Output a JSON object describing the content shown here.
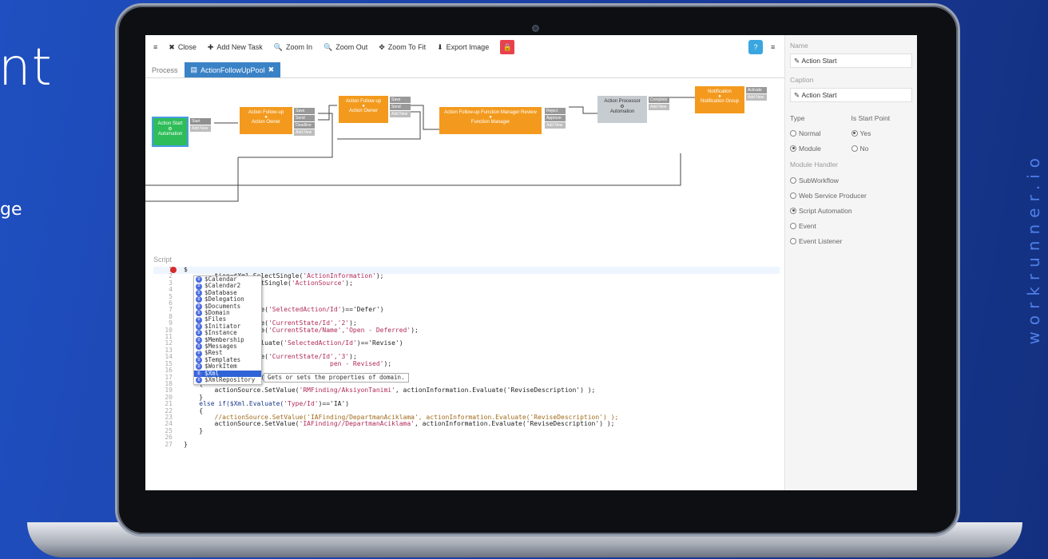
{
  "hero": {
    "title": "nt",
    "subtitle": "ge"
  },
  "brand": {
    "vertical": "workrunner.io"
  },
  "toolbar": {
    "menu_icon": "≡",
    "close": "Close",
    "add_task": "Add New Task",
    "zoom_in": "Zoom In",
    "zoom_out": "Zoom Out",
    "zoom_fit": "Zoom To Fit",
    "export": "Export Image",
    "help": "?",
    "menu2": "≡"
  },
  "tabs": {
    "process": "Process",
    "active": "ActionFollowUpPool"
  },
  "diagram": {
    "nodes": [
      {
        "title": "Action Start",
        "sub": "Automation",
        "color": "#2ebd59",
        "ports": [
          "Start",
          "Add New"
        ]
      },
      {
        "title": "Action Follow-up",
        "sub": "Action Owner",
        "color": "#f39a1e",
        "ports": [
          "Save",
          "Send",
          "Deadline",
          "Add New"
        ]
      },
      {
        "title": "Action Follow-up",
        "sub": "Action Owner",
        "color": "#f39a1e",
        "ports": [
          "Save",
          "Send",
          "Add New"
        ]
      },
      {
        "title": "Action Follow-up Function Manager Review",
        "sub": "Function Manager",
        "color": "#f39a1e",
        "ports": [
          "Reject",
          "Approve",
          "Add New"
        ]
      },
      {
        "title": "Action Processor",
        "sub": "Automation",
        "color": "#c7ccd0",
        "ports": [
          "Complete",
          "Add New"
        ]
      },
      {
        "title": "Notification",
        "sub": "Notification Group",
        "color": "#f39a1e",
        "ports": [
          "Activate",
          "Add New"
        ]
      }
    ]
  },
  "editor": {
    "label": "Script",
    "lines": [
      "1",
      "2",
      "3",
      "4",
      "5",
      "6",
      "7",
      "8",
      "9",
      "10",
      "11",
      "12",
      "13",
      "14",
      "15",
      "16",
      "17",
      "18",
      "19",
      "20",
      "21",
      "22",
      "23",
      "24",
      "25",
      "26",
      "27"
    ],
    "line1": "$",
    "code": [
      {
        "pre": "        tion=$Xml.SelectSingle(",
        "str": "'ActionInformation'",
        "post": ");"
      },
      {
        "pre": "        = $Xml.SelectSingle(",
        "str": "'ActionSource'",
        "post": ");"
      },
      {
        "pre": "        null;",
        "str": "",
        "post": ""
      },
      {
        "pre": "",
        "str": "",
        "post": ""
      },
      {
        "pre": "",
        "str": "",
        "post": ""
      },
      {
        "pre": "        tion.Evaluate(",
        "str": "'SelectedAction/Id'",
        "post": ")=='Defer')"
      },
      {
        "pre": "",
        "str": "",
        "post": ""
      },
      {
        "pre": "        tion.SetValue(",
        "str": "'CurrentState/Id','2'",
        "post": ");"
      },
      {
        "pre": "        tion.SetValue(",
        "str": "'CurrentState/Name','Open - Deferred'",
        "post": ");"
      },
      {
        "pre": "",
        "str": "",
        "post": ""
      },
      {
        "pre": "        ormation.Evaluate(",
        "str": "'SelectedAction/Id'",
        "post": ")=='Revise')"
      },
      {
        "pre": "",
        "str": "",
        "post": ""
      },
      {
        "pre": "        tion.SetValue(",
        "str": "'CurrentState/Id','3'",
        "post": ");"
      },
      {
        "pre": "                                      ",
        "str": "pen - Revised'",
        "post": ");"
      },
      {
        "pre": "",
        "str": "",
        "post": ""
      },
      {
        "pre": "    if($Xml.Evaluate(",
        "str": "'Type/Id'",
        "post": ")=='RM')"
      },
      {
        "pre": "    {",
        "str": "",
        "post": ""
      },
      {
        "pre": "        actionSource.SetValue(",
        "str": "'RMFinding/AksiyonTanimi'",
        "post": ", actionInformation.Evaluate('ReviseDescription') );"
      },
      {
        "pre": "    }",
        "str": "",
        "post": ""
      },
      {
        "pre": "    else if($Xml.Evaluate(",
        "str": "'Type/Id'",
        "post": ")=='IA')"
      },
      {
        "pre": "    {",
        "str": "",
        "post": ""
      },
      {
        "pre": "        //actionSource.SetValue('IAFinding/DepartmanAciklama', actionInformation.Evaluate('ReviseDescription') );",
        "str": "",
        "post": ""
      },
      {
        "pre": "        actionSource.SetValue(",
        "str": "'IAFinding//DepartmanAciklama'",
        "post": ", actionInformation.Evaluate('ReviseDescription') );"
      },
      {
        "pre": "    }",
        "str": "",
        "post": ""
      },
      {
        "pre": "",
        "str": "",
        "post": ""
      },
      {
        "pre": "}",
        "str": "",
        "post": ""
      }
    ],
    "autocomplete": [
      "$Calendar",
      "$Calendar2",
      "$Database",
      "$Delegation",
      "$Documents",
      "$Domain",
      "$Files",
      "$Initiator",
      "$Instance",
      "$Membership",
      "$Messages",
      "$Rest",
      "$Templates",
      "$WorkItem",
      "$Xml",
      "$XmlRepository"
    ],
    "selected_index": 14,
    "tooltip": "Gets or sets the properties of domain."
  },
  "panel": {
    "name_label": "Name",
    "name_value": "Action Start",
    "caption_label": "Caption",
    "caption_value": "Action Start",
    "type_label": "Type",
    "start_label": "Is Start Point",
    "type_normal": "Normal",
    "type_module": "Module",
    "start_yes": "Yes",
    "start_no": "No",
    "handler_label": "Module Handler",
    "handlers": [
      "SubWorkflow",
      "Web Service Producer",
      "Script Automation",
      "Event",
      "Event Listener"
    ],
    "handler_selected": 2
  }
}
